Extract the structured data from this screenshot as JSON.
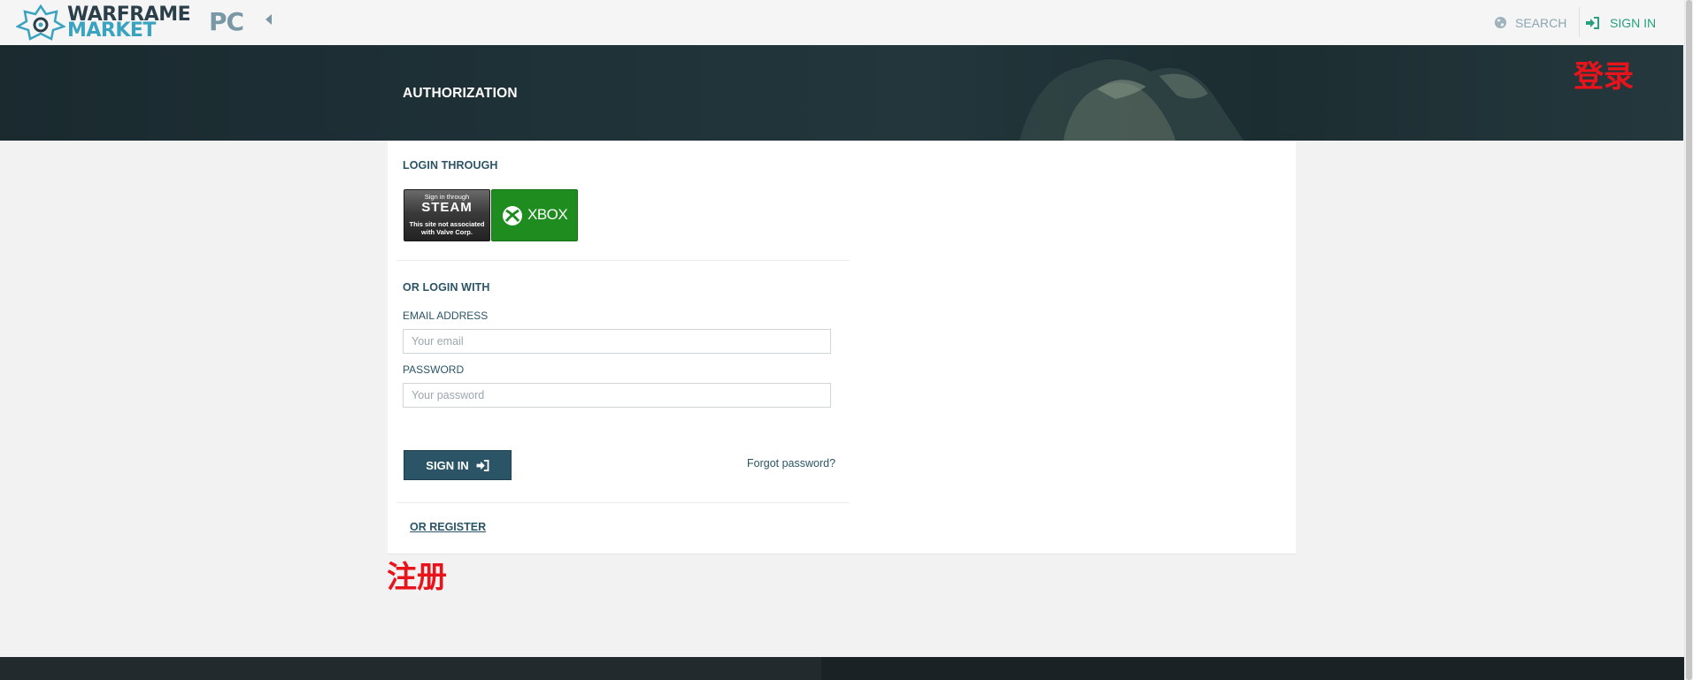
{
  "header": {
    "logo_line1": "WARFRAME",
    "logo_line2": "MARKET",
    "platform": "PC",
    "search_label": "SEARCH",
    "sign_in_label": "SIGN IN",
    "icons": {
      "search": "globe-icon",
      "sign_in": "sign-in-icon",
      "collapse": "caret-left-icon"
    }
  },
  "hero": {
    "title": "AUTHORIZATION"
  },
  "annotations": {
    "login": "登录",
    "register": "注册"
  },
  "login": {
    "through_heading": "LOGIN THROUGH",
    "steam": {
      "line1": "Sign in through",
      "line2": "STEAM",
      "line3a": "This site not associated",
      "line3b": "with Valve Corp."
    },
    "xbox": {
      "label": "XBOX"
    },
    "or_login_heading": "OR LOGIN WITH",
    "email_label": "EMAIL ADDRESS",
    "email_placeholder": "Your email",
    "password_label": "PASSWORD",
    "password_placeholder": "Your password",
    "sign_in_button": "SIGN IN",
    "forgot_password": "Forgot password?",
    "register_link": "OR REGISTER"
  },
  "colors": {
    "primary": "#2b5566",
    "sign_in_accent": "#27a07f",
    "xbox_green": "#1f8c1f",
    "annotation_red": "#e8141b",
    "hero_dark": "#1e3137"
  }
}
